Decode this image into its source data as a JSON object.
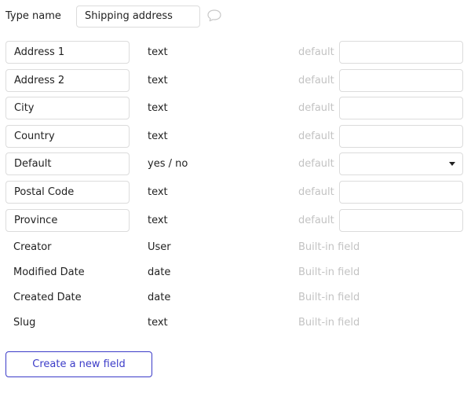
{
  "header": {
    "type_name_label": "Type name",
    "type_name_value": "Shipping address",
    "comment_icon": "speech-bubble-icon"
  },
  "fields": [
    {
      "name": "Address 1",
      "type": "text",
      "default_label": "default",
      "default_value": "",
      "editable": true,
      "dropdown": false
    },
    {
      "name": "Address 2",
      "type": "text",
      "default_label": "default",
      "default_value": "",
      "editable": true,
      "dropdown": false
    },
    {
      "name": "City",
      "type": "text",
      "default_label": "default",
      "default_value": "",
      "editable": true,
      "dropdown": false
    },
    {
      "name": "Country",
      "type": "text",
      "default_label": "default",
      "default_value": "",
      "editable": true,
      "dropdown": false
    },
    {
      "name": "Default",
      "type": "yes / no",
      "default_label": "default",
      "default_value": "",
      "editable": true,
      "dropdown": true
    },
    {
      "name": "Postal Code",
      "type": "text",
      "default_label": "default",
      "default_value": "",
      "editable": true,
      "dropdown": false
    },
    {
      "name": "Province",
      "type": "text",
      "default_label": "default",
      "default_value": "",
      "editable": true,
      "dropdown": false
    }
  ],
  "builtin_fields": [
    {
      "name": "Creator",
      "type": "User",
      "note": "Built-in field"
    },
    {
      "name": "Modified Date",
      "type": "date",
      "note": "Built-in field"
    },
    {
      "name": "Created Date",
      "type": "date",
      "note": "Built-in field"
    },
    {
      "name": "Slug",
      "type": "text",
      "note": "Built-in field"
    }
  ],
  "actions": {
    "create_field_label": "Create a new field"
  },
  "colors": {
    "accent": "#3c3cc8",
    "muted_text": "#c3c3c3",
    "border": "#dcdcdc"
  }
}
